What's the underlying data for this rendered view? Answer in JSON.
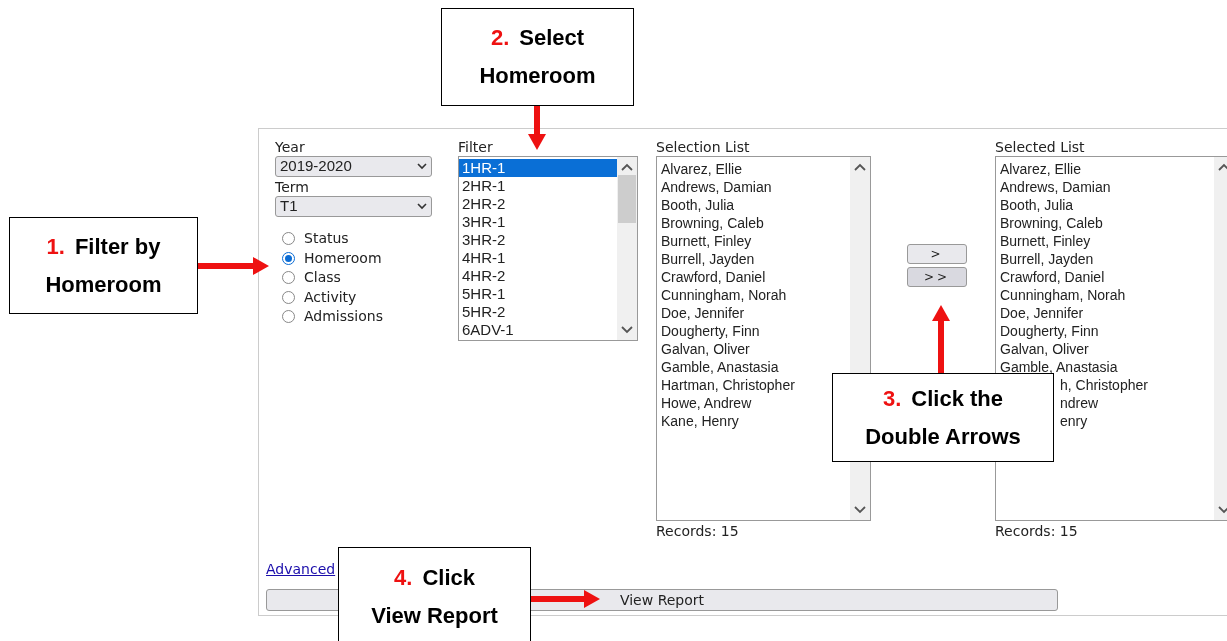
{
  "form": {
    "year": {
      "label": "Year",
      "value": "2019-2020"
    },
    "term": {
      "label": "Term",
      "value": "T1"
    },
    "filter_by": [
      {
        "label": "Status",
        "selected": false
      },
      {
        "label": "Homeroom",
        "selected": true
      },
      {
        "label": "Class",
        "selected": false
      },
      {
        "label": "Activity",
        "selected": false
      },
      {
        "label": "Admissions",
        "selected": false
      }
    ],
    "filter": {
      "label": "Filter",
      "items": [
        {
          "label": "1HR-1",
          "selected": true
        },
        {
          "label": "2HR-1",
          "selected": false
        },
        {
          "label": "2HR-2",
          "selected": false
        },
        {
          "label": "3HR-1",
          "selected": false
        },
        {
          "label": "3HR-2",
          "selected": false
        },
        {
          "label": "4HR-1",
          "selected": false
        },
        {
          "label": "4HR-2",
          "selected": false
        },
        {
          "label": "5HR-1",
          "selected": false
        },
        {
          "label": "5HR-2",
          "selected": false
        },
        {
          "label": "6ADV-1",
          "selected": false
        }
      ]
    },
    "selection_list": {
      "label": "Selection List",
      "records": "Records: 15",
      "items": [
        {
          "label": "Alvarez, Ellie"
        },
        {
          "label": "Andrews, Damian"
        },
        {
          "label": "Booth, Julia"
        },
        {
          "label": "Browning, Caleb"
        },
        {
          "label": "Burnett, Finley"
        },
        {
          "label": "Burrell, Jayden"
        },
        {
          "label": "Crawford, Daniel"
        },
        {
          "label": "Cunningham, Norah"
        },
        {
          "label": "Doe, Jennifer"
        },
        {
          "label": "Dougherty, Finn"
        },
        {
          "label": "Galvan, Oliver"
        },
        {
          "label": "Gamble, Anastasia"
        },
        {
          "label": "Hartman, Christopher"
        },
        {
          "label": "Howe, Andrew"
        },
        {
          "label": "Kane, Henry"
        }
      ]
    },
    "move_buttons": [
      {
        "label": ">"
      },
      {
        "label": ">>"
      }
    ],
    "selected_list": {
      "label": "Selected List",
      "records": "Records: 15",
      "items": [
        {
          "label": "Alvarez, Ellie",
          "kind": "full"
        },
        {
          "label": "Andrews, Damian",
          "kind": "full"
        },
        {
          "label": "Booth, Julia",
          "kind": "full"
        },
        {
          "label": "Browning, Caleb",
          "kind": "full"
        },
        {
          "label": "Burnett, Finley",
          "kind": "full"
        },
        {
          "label": "Burrell, Jayden",
          "kind": "full"
        },
        {
          "label": "Crawford, Daniel",
          "kind": "full"
        },
        {
          "label": "Cunningham, Norah",
          "kind": "full"
        },
        {
          "label": "Doe, Jennifer",
          "kind": "full"
        },
        {
          "label": "Dougherty, Finn",
          "kind": "full"
        },
        {
          "label": "Galvan, Oliver",
          "kind": "full"
        },
        {
          "label": "Gamble, Anastasia",
          "kind": "full"
        },
        {
          "label": "h, Christopher",
          "kind": "partial"
        },
        {
          "label": "ndrew",
          "kind": "partial"
        },
        {
          "label": "enry",
          "kind": "partial"
        }
      ]
    },
    "advanced_link": "Advanced",
    "view_report": "View Report"
  },
  "callouts": [
    {
      "number": "1.",
      "lines": [
        "Filter by",
        "Homeroom"
      ]
    },
    {
      "number": "2.",
      "lines": [
        "Select",
        "Homeroom"
      ]
    },
    {
      "number": "3.",
      "lines": [
        "Click the",
        "Double Arrows"
      ]
    },
    {
      "number": "4.",
      "lines": [
        "Click",
        "View Report"
      ]
    }
  ]
}
